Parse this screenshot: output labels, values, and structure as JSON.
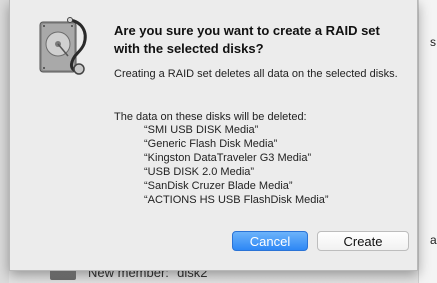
{
  "background": {
    "member_row_text": "New member: \"disk2",
    "right_panel_fragments": [
      "s",
      "a"
    ]
  },
  "dialog": {
    "title": "Are you sure you want to create a RAID set with the selected disks?",
    "message": "Creating a RAID set deletes all data on the selected disks.",
    "disks_heading": "The data on these disks will be deleted:",
    "disks": [
      "“SMI USB DISK Media”",
      "“Generic Flash Disk Media”",
      "“Kingston DataTraveler G3 Media”",
      "“USB DISK 2.0 Media”",
      "“SanDisk Cruzer Blade Media”",
      "“ACTIONS HS USB FlashDisk Media”"
    ],
    "app_icon": "disk-utility-icon",
    "buttons": {
      "cancel_label": "Cancel",
      "create_label": "Create"
    }
  },
  "colors": {
    "default_button": "#3a8ef6",
    "sheet_background": "#ececec"
  }
}
